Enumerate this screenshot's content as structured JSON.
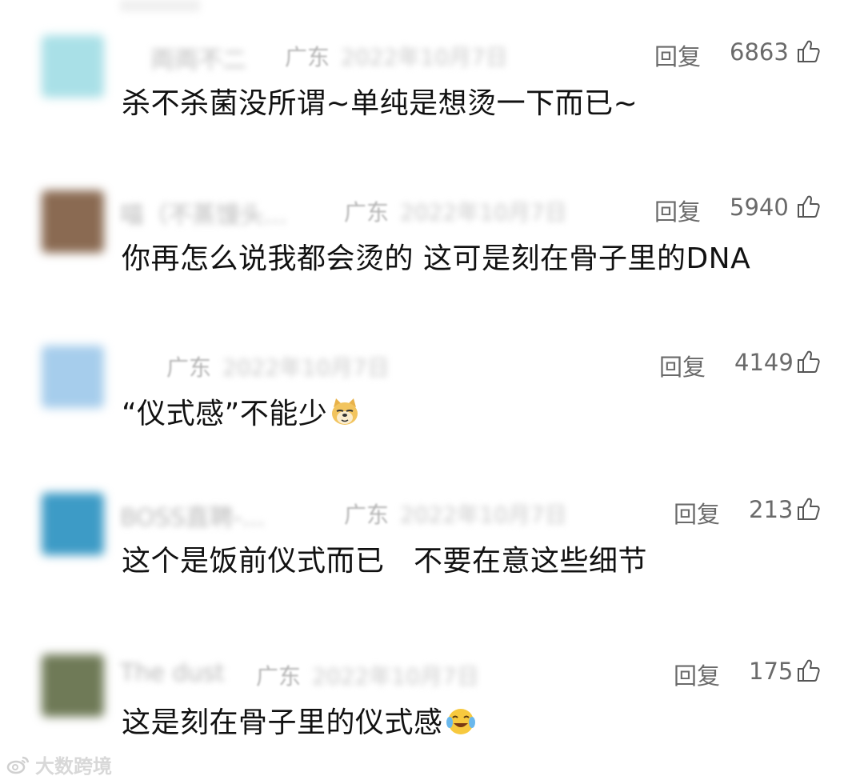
{
  "comments": [
    {
      "name": "両両不二",
      "region": "广东",
      "date": "2022年10月7日",
      "reply_label": "回复",
      "likes": "6863",
      "text": "杀不杀菌没所谓~单纯是想烫一下而已~",
      "avatar_color": "#a9e0e7"
    },
    {
      "name": "喵（不蒸馒头...",
      "region": "广东",
      "date": "2022年10月7日",
      "reply_label": "回复",
      "likes": "5940",
      "text": "你再怎么说我都会烫的 这可是刻在骨子里的DNA",
      "avatar_color": "#8a6a52"
    },
    {
      "name": "",
      "region": "广东",
      "date": "2022年10月7日",
      "reply_label": "回复",
      "likes": "4149",
      "text": "“仪式感”不能少",
      "emoji": "doge-emoji",
      "avatar_color": "#a6cdec"
    },
    {
      "name": "BOSS直聘-...",
      "region": "广东",
      "date": "2022年10月7日",
      "reply_label": "回复",
      "likes": "213",
      "text": "这个是饭前仪式而已　不要在意这些细节",
      "avatar_color": "#3d9bc6"
    },
    {
      "name": "The dust",
      "region": "广东",
      "date": "2022年10月7日",
      "reply_label": "回复",
      "likes": "175",
      "text": "这是刻在骨子里的仪式感",
      "emoji": "laugh-cry-emoji",
      "avatar_color": "#6f7a57"
    }
  ],
  "watermark": {
    "text": "大数跨境",
    "icon": "weibo-logo-icon"
  },
  "icons": {
    "like": "thumbs-up-icon"
  }
}
